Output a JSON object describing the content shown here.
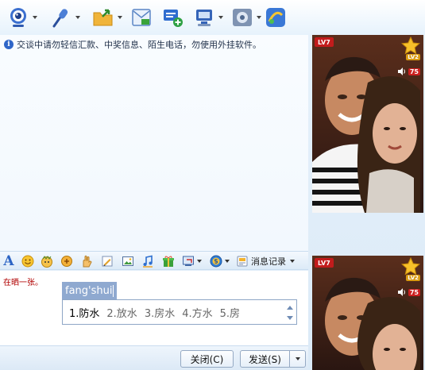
{
  "toolbar": {
    "icons": [
      "webcam-icon",
      "microphone-icon",
      "folder-transfer-icon",
      "sms-icon",
      "create-discussion-icon",
      "remote-assist-icon",
      "settings-icon",
      "app-launcher-icon"
    ]
  },
  "message_area": {
    "notice": "交谈中请勿轻信汇款、中奖信息、陌生电话，勿使用外挂软件。"
  },
  "format_bar": {
    "font_label": "A",
    "history_label": "消息记录"
  },
  "input": {
    "typed_text": "在晒一张。",
    "ime": {
      "composition": "fang'shui",
      "candidates": [
        "1.防水",
        "2.放水",
        "3.房水",
        "4.方水",
        "5.房"
      ]
    }
  },
  "buttons": {
    "close": "关闭(C)",
    "send": "发送(S)"
  },
  "video": {
    "level_badge": "LV7",
    "star_level": "LV2",
    "volume_badge": "75"
  },
  "colors": {
    "accent": "#2c64c4",
    "typed_text": "#b00000",
    "badge_red": "#c21c1c",
    "ime_highlight": "#8fa9d0"
  }
}
